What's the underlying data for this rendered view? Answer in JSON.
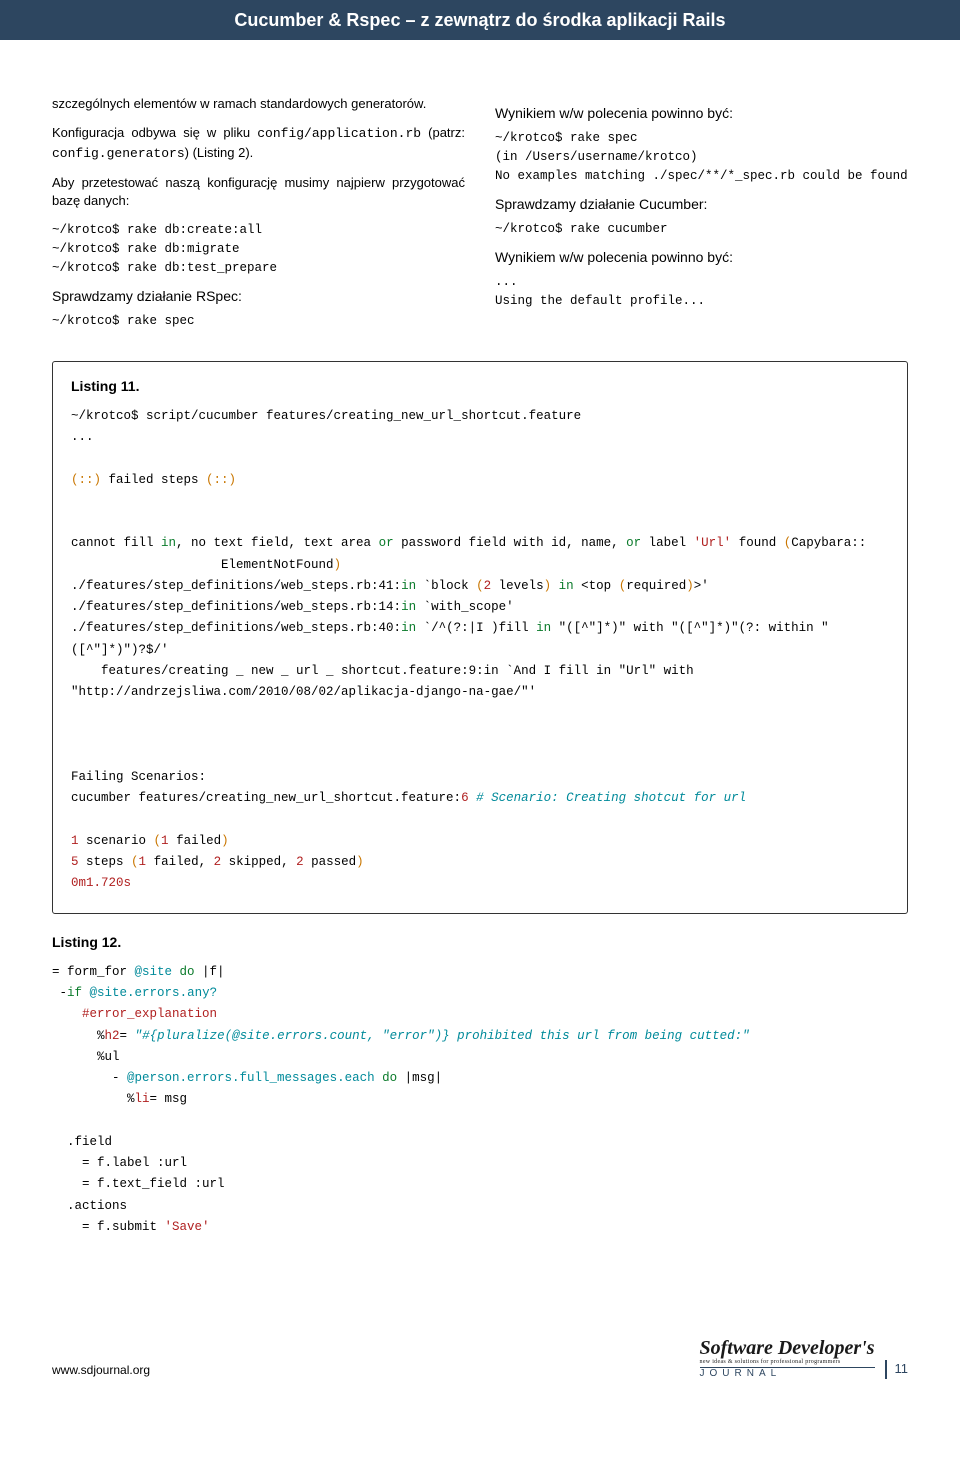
{
  "header": "Cucumber & Rspec – z zewnątrz do środka aplikacji Rails",
  "left": {
    "p1a": "szczególnych elementów w ramach standardowych generatorów.",
    "p1b_pre": "Konfiguracja odbywa się w pliku ",
    "p1b_code1": "config/application.rb",
    "p1b_mid": " (patrz: ",
    "p1b_code2": "config.generators",
    "p1b_post": ") (Listing 2).",
    "p2": "Aby przetestować naszą konfigurację musimy najpierw przygotować bazę danych:",
    "code1": "~/krotco$ rake db:create:all\n~/krotco$ rake db:migrate\n~/krotco$ rake db:test_prepare",
    "sub1": "Sprawdzamy działanie RSpec:",
    "code2": "~/krotco$ rake spec"
  },
  "right": {
    "sub1": "Wynikiem w/w polecenia powinno być:",
    "code1": "~/krotco$ rake spec\n(in /Users/username/krotco)\nNo examples matching ./spec/**/*_spec.rb could be found",
    "sub2": "Sprawdzamy działanie Cucumber:",
    "code2": "~/krotco$ rake cucumber",
    "sub3": "Wynikiem w/w polecenia powinno być:",
    "code3": "...\nUsing the default profile..."
  },
  "listing11": {
    "title": "Listing 11.",
    "l1": "~/krotco$ script/cucumber features/creating_new_url_shortcut.feature",
    "l2": "...",
    "fs_open": "(::)",
    "fs_text": " failed steps ",
    "fs_close": "(::)",
    "c_pre": "cannot fill ",
    "c_in": "in",
    "c_mid1": ", no text field, text area ",
    "c_or": "or",
    "c_mid2": " password field with id, name, ",
    "c_or2": "or",
    "c_mid3": " label ",
    "c_lbl": "'Url'",
    "c_found": " found ",
    "c_paren": "(",
    "c_cap": "Capybara::\n                    ElementNotFound",
    "c_paren2": ")",
    "s1a": "./features/step_definitions/web_steps.rb:41:",
    "s1_in": "in",
    "s1b": " `block ",
    "s1_p1": "(",
    "s1_n": "2",
    "s1_lvl": " levels",
    "s1_p2": ")",
    "s1_in2": " in",
    "s1_c": " <top ",
    "s1_p3": "(",
    "s1_req": "required",
    "s1_p4": ")",
    "s1_d": ">'",
    "s2a": "./features/step_definitions/web_steps.rb:14:",
    "s2_in": "in",
    "s2b": " `with_scope'",
    "s3a": "./features/step_definitions/web_steps.rb:40:",
    "s3_in": "in",
    "s3b": " `/^(?:|I )fill ",
    "s3_in2": "in",
    "s3c": " \"([^\"]*)\" with \"([^\"]*)\"(?: within \"([^\"]*)\")?$/'",
    "s4": "    features/creating _ new _ url _ shortcut.feature:9:in `And I fill in \"Url\" with \"http://andrzejsliwa.com/2010/08/02/aplikacja-django-na-gae/\"'",
    "fs2": "Failing Scenarios:",
    "cu_a": "cucumber features/creating_new_url_shortcut.feature:",
    "cu_n": "6",
    "cu_c": " # Scenario: Creating shotcut for url",
    "r1a": "1",
    "r1b": " scenario ",
    "r1c": "(",
    "r1d": "1",
    "r1e": " failed",
    "r1f": ")",
    "r2a": "5",
    "r2b": " steps ",
    "r2c": "(",
    "r2d": "1",
    "r2e": " failed, ",
    "r2f": "2",
    "r2g": " skipped, ",
    "r2h": "2",
    "r2i": " passed",
    "r2j": ")",
    "r3": "0m1.720s"
  },
  "listing12": {
    "title": "Listing 12.",
    "a1": "= form_for ",
    "a2": "@site",
    "a3": " do ",
    "a4": "|f|",
    "b1": " -",
    "b2": "if",
    "b3": " @site.errors.any?",
    "c1": "    #error_explanation",
    "d1": "      %",
    "d2": "h2",
    "d3": "= ",
    "d4": "\"#{pluralize(@site.errors.count, \"error\")} prohibited this url from being cutted:\"",
    "e1": "      %ul",
    "f1": "        - ",
    "f2": "@person.errors.full_messages.each",
    "f3": " do ",
    "f4": "|msg|",
    "g1": "          %",
    "g2": "li",
    "g3": "= msg",
    "h1": "  .field",
    "i1": "    = f.label :url",
    "j1": "    = f.text_field :url",
    "k1": "  .actions",
    "l1": "    = f.submit ",
    "l2": "'Save'"
  },
  "footer": {
    "url": "www.sdjournal.org",
    "logo_main": "Software Developer's",
    "logo_sub": "new ideas & solutions for professional programmers",
    "logo_journal": "JOURNAL",
    "page": "11"
  }
}
